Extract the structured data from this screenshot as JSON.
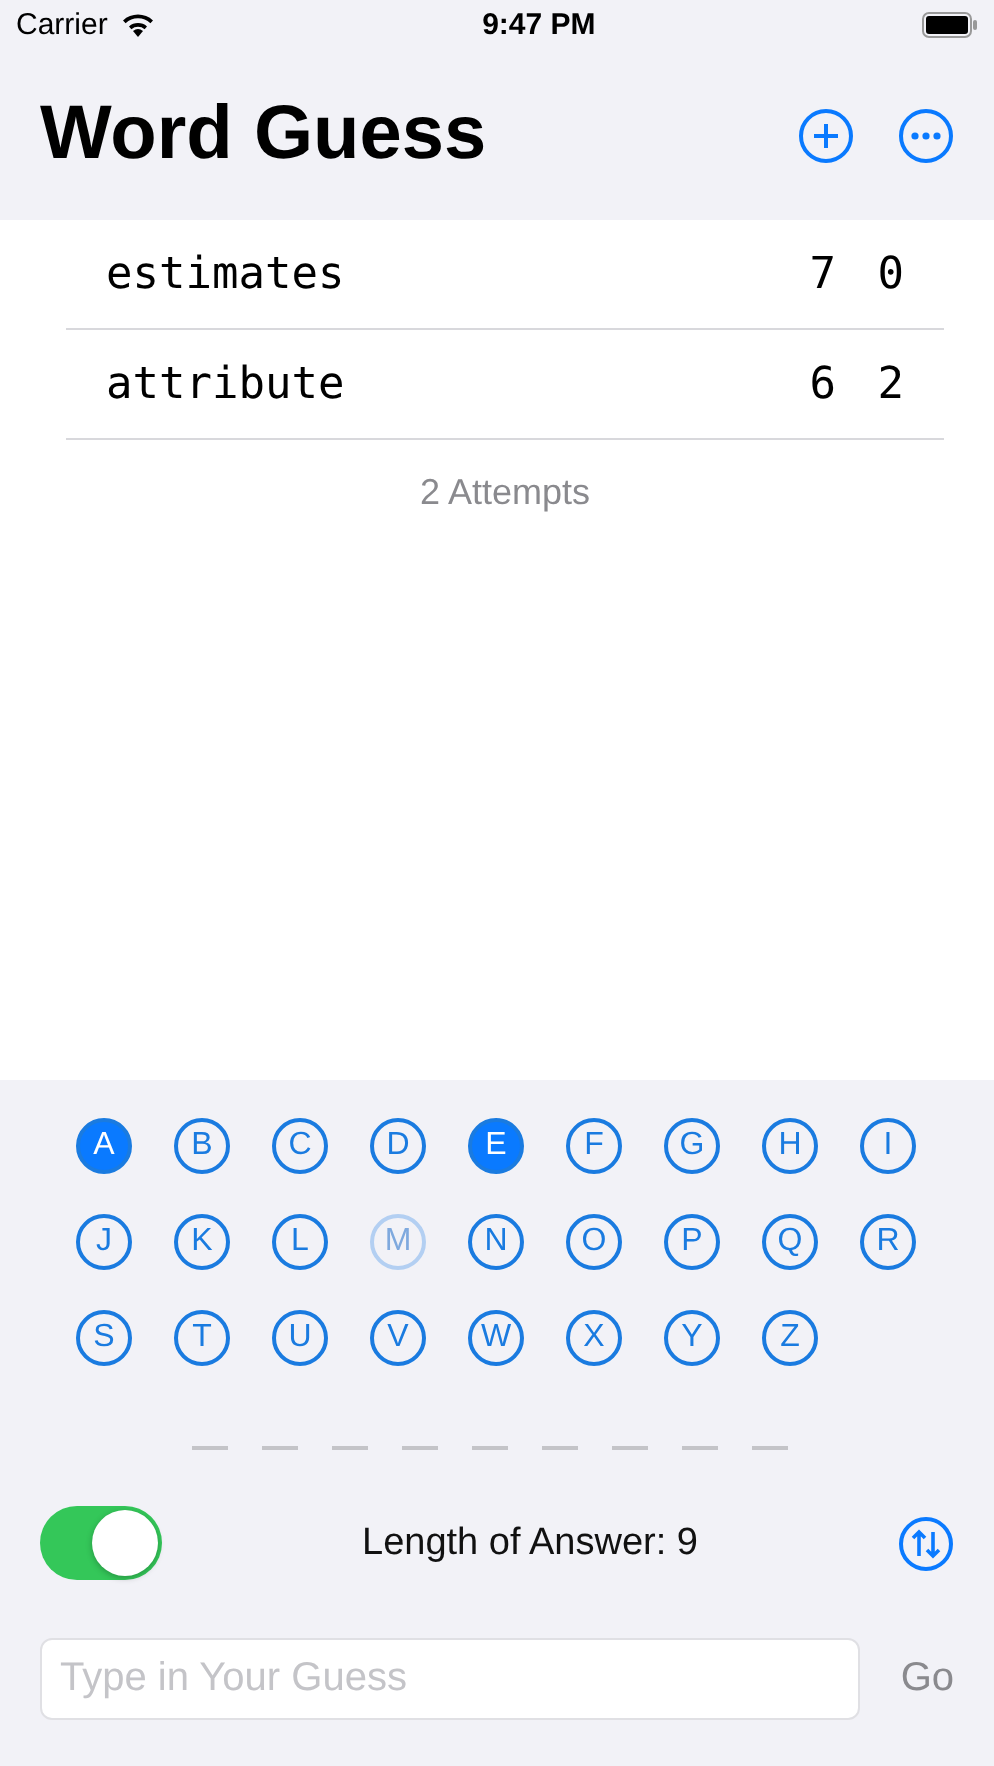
{
  "status_bar": {
    "carrier": "Carrier",
    "time": "9:47 PM"
  },
  "title": "Word Guess",
  "attempts": [
    {
      "word": "estimates",
      "column_2": "7",
      "column_3": "0"
    },
    {
      "word": "attribute",
      "column_2": "6",
      "column_3": "2"
    }
  ],
  "attempts_footer": "2 Attempts",
  "letters": [
    {
      "label": "A",
      "selected": true,
      "disabled": false
    },
    {
      "label": "B",
      "selected": false,
      "disabled": false
    },
    {
      "label": "C",
      "selected": false,
      "disabled": false
    },
    {
      "label": "D",
      "selected": false,
      "disabled": false
    },
    {
      "label": "E",
      "selected": true,
      "disabled": false
    },
    {
      "label": "F",
      "selected": false,
      "disabled": false
    },
    {
      "label": "G",
      "selected": false,
      "disabled": false
    },
    {
      "label": "H",
      "selected": false,
      "disabled": false
    },
    {
      "label": "I",
      "selected": false,
      "disabled": false
    },
    {
      "label": "J",
      "selected": false,
      "disabled": false
    },
    {
      "label": "K",
      "selected": false,
      "disabled": false
    },
    {
      "label": "L",
      "selected": false,
      "disabled": false
    },
    {
      "label": "M",
      "selected": false,
      "disabled": true
    },
    {
      "label": "N",
      "selected": false,
      "disabled": false
    },
    {
      "label": "O",
      "selected": false,
      "disabled": false
    },
    {
      "label": "P",
      "selected": false,
      "disabled": false
    },
    {
      "label": "Q",
      "selected": false,
      "disabled": false
    },
    {
      "label": "R",
      "selected": false,
      "disabled": false
    },
    {
      "label": "S",
      "selected": false,
      "disabled": false
    },
    {
      "label": "T",
      "selected": false,
      "disabled": false
    },
    {
      "label": "U",
      "selected": false,
      "disabled": false
    },
    {
      "label": "V",
      "selected": false,
      "disabled": false
    },
    {
      "label": "W",
      "selected": false,
      "disabled": false
    },
    {
      "label": "X",
      "selected": false,
      "disabled": false
    },
    {
      "label": "Y",
      "selected": false,
      "disabled": false
    },
    {
      "label": "Z",
      "selected": false,
      "disabled": false
    }
  ],
  "answer_slots": [
    {
      "revealed": false
    },
    {
      "revealed": false
    },
    {
      "revealed": false
    },
    {
      "revealed": false
    },
    {
      "revealed": false
    },
    {
      "revealed": false
    },
    {
      "revealed": false
    },
    {
      "revealed": false
    },
    {
      "revealed": false
    }
  ],
  "toggle": {
    "on": true
  },
  "length_label": "Length of Answer: 9",
  "guess_field": {
    "placeholder": "Type in Your Guess"
  },
  "go_button": {
    "label": "Go",
    "disabled": true
  }
}
